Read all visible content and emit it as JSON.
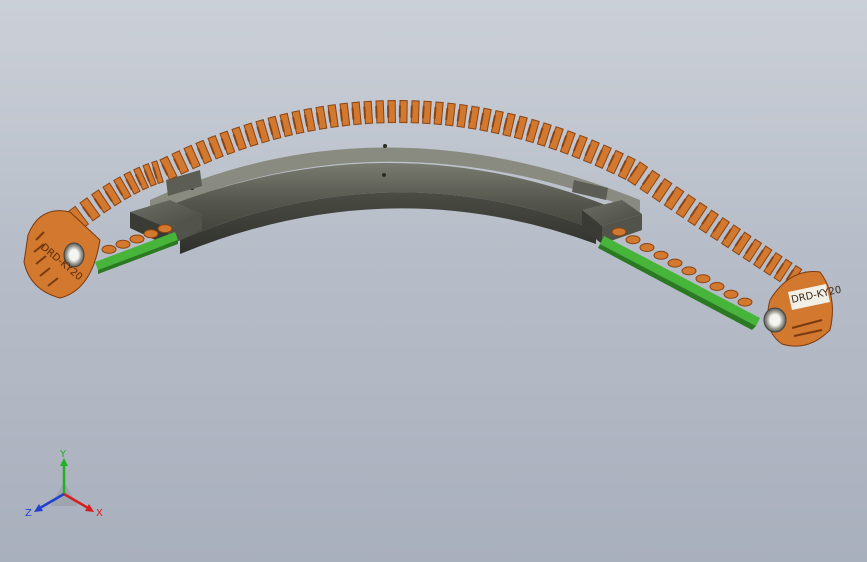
{
  "viewport": {
    "background_top": "#cbd0d8",
    "background_bottom": "#a9b0bd"
  },
  "model": {
    "chain_color": "#d2782f",
    "chain_dark": "#8a4413",
    "rail_color": "#4a4b43",
    "rail_top": "#6b6c62",
    "strip_color": "#46b53a",
    "end_label_right": "DRD-KY20",
    "end_label_left": "DRD-KY20"
  },
  "triad": {
    "x_label": "X",
    "y_label": "Y",
    "z_label": "Z",
    "x_color": "#d42020",
    "y_color": "#20b020",
    "z_color": "#2040d0"
  }
}
